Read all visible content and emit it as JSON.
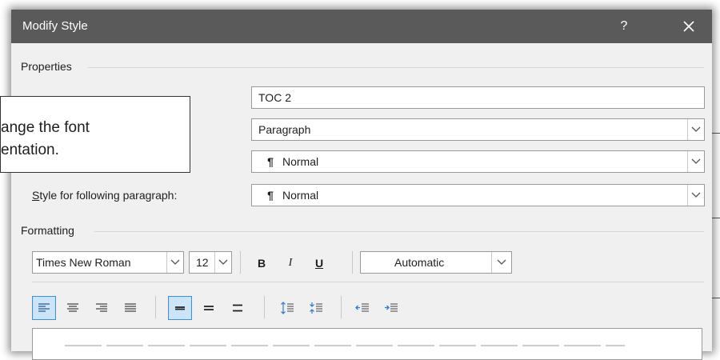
{
  "dialog": {
    "title": "Modify Style",
    "help_label": "?"
  },
  "properties": {
    "section_label": "Properties",
    "name_value": "TOC 2",
    "style_type_value": "Paragraph",
    "style_based_on_value": "Normal",
    "following_label_rest": "tyle for following paragraph:",
    "following_label_accel": "S",
    "following_value": "Normal"
  },
  "formatting": {
    "section_label": "Formatting",
    "font_name": "Times New Roman",
    "font_size": "12",
    "bold_label": "B",
    "italic_label": "I",
    "underline_label": "U",
    "color_value": "Automatic"
  },
  "callout": {
    "line1": "ange the font",
    "line2": "entation."
  },
  "colors": {
    "titlebar": "#5a5a5a",
    "dialog_bg": "#f0f0f0",
    "align_left_selected_bg": "#cce4f7",
    "align_left_selected_border": "#3d8ee0"
  },
  "icons": [
    "close-icon",
    "chevron-down-icon",
    "pilcrow-icon",
    "align-left-icon",
    "align-center-icon",
    "align-right-icon",
    "justify-icon",
    "single-spacing-icon",
    "one-half-spacing-icon",
    "double-spacing-icon",
    "increase-paragraph-spacing-icon",
    "decrease-paragraph-spacing-icon",
    "decrease-indent-icon",
    "increase-indent-icon"
  ]
}
